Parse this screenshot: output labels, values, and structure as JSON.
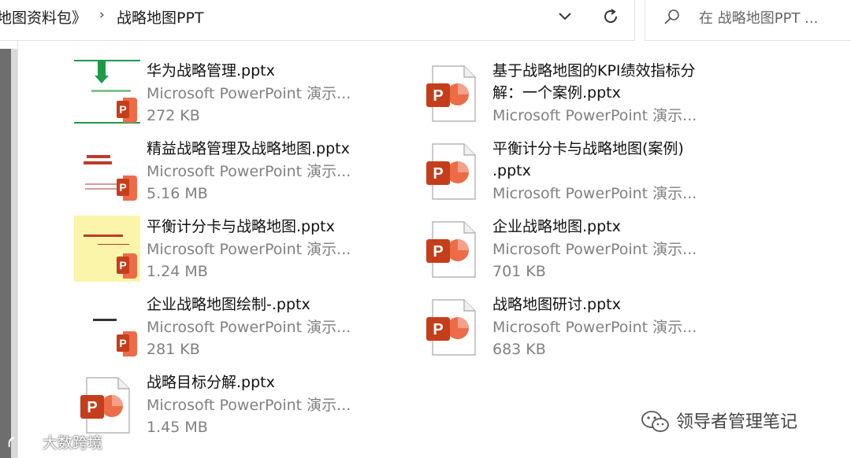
{
  "address_bar": {
    "crumb_parent": "地图资料包》",
    "crumb_current": "战略地图PPT",
    "separator": "›"
  },
  "search": {
    "placeholder": "在 战略地图PPT ..."
  },
  "files_left": [
    {
      "name": "华为战略管理.pptx",
      "type": "Microsoft PowerPoint 演示...",
      "size": "272 KB",
      "thumb": "green-thumbnail"
    },
    {
      "name": "精益战略管理及战略地图.pptx",
      "type": "Microsoft PowerPoint 演示...",
      "size": "5.16 MB",
      "thumb": "red-title-thumbnail"
    },
    {
      "name": "平衡计分卡与战略地图.pptx",
      "type": "Microsoft PowerPoint 演示...",
      "size": "1.24 MB",
      "thumb": "yellow-thumbnail"
    },
    {
      "name": "企业战略地图绘制-.pptx",
      "type": "Microsoft PowerPoint 演示...",
      "size": "281 KB",
      "thumb": "white-thumbnail"
    },
    {
      "name": "战略目标分解.pptx",
      "type": "Microsoft PowerPoint 演示...",
      "size": "1.45 MB",
      "thumb": "ppt-file-icon"
    }
  ],
  "files_right": [
    {
      "name1": "基于战略地图的KPI绩效指标分",
      "name2": "解：一个案例.pptx",
      "type": "Microsoft PowerPoint 演示..."
    },
    {
      "name1": "平衡计分卡与战略地图(案例)",
      "name2": ".pptx",
      "type": "Microsoft PowerPoint 演示..."
    },
    {
      "name": "企业战略地图.pptx",
      "type": "Microsoft PowerPoint 演示...",
      "size": "701 KB"
    },
    {
      "name": "战略地图研讨.pptx",
      "type": "Microsoft PowerPoint 演示...",
      "size": "683 KB"
    }
  ],
  "icons": {
    "ppt_letter": "P"
  },
  "watermarks": {
    "right": "领导者管理笔记",
    "left": "大数跨境"
  },
  "colors": {
    "ppt_red": "#c43e1c",
    "ppt_orange": "#ed6c47",
    "thumb_yellow": "#fbf5a9",
    "green": "#1e9a4a"
  }
}
